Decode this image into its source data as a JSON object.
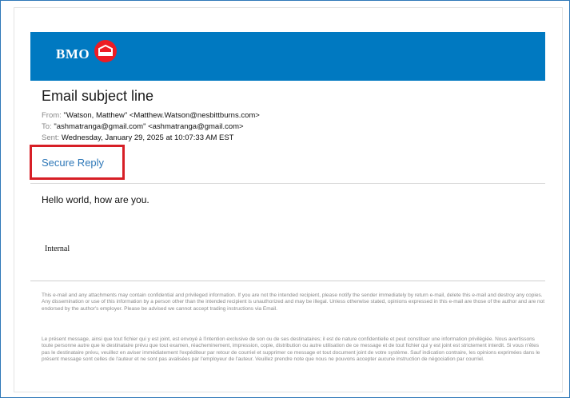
{
  "brand": {
    "name": "BMO",
    "banner_color": "#0079c1",
    "roundel_color": "#ed1c24",
    "roundel_icon": "bmo-roundel-icon"
  },
  "email": {
    "subject": "Email subject line",
    "from_label": "From:",
    "from_value": "\"Watson, Matthew\" <Matthew.Watson@nesbittburns.com>",
    "to_label": "To:",
    "to_value": "\"ashmatranga@gmail.com\" <ashmatranga@gmail.com>",
    "sent_label": "Sent:",
    "sent_value": "Wednesday, January 29, 2025 at 10:07:33 AM EST",
    "secure_reply": "Secure Reply",
    "body": "Hello world, how are you.",
    "classification": "Internal"
  },
  "disclaimer": {
    "english": "This e-mail and any attachments may contain confidential and privileged information. If you are not the intended recipient, please notify the sender immediately by return e-mail, delete this e-mail and destroy any copies. Any dissemination or use of this information by a person other than the intended recipient is unauthorized and may be illegal. Unless otherwise stated, opinions expressed in this e-mail are those of the author and are not endorsed by the author's employer. Please be advised we cannot accept trading instructions via Email.",
    "french": "Le présent message, ainsi que tout fichier qui y est joint, est envoyé à l'intention exclusive de son ou de ses destinataires; il est de nature confidentielle et peut constituer une information privilégiée. Nous avertissons toute personne autre que le destinataire prévu que tout examen, réacheminement, impression, copie, distribution ou autre utilisation de ce message et de tout fichier qui y est joint est strictement interdit. Si vous n'êtes pas le destinataire prévu, veuillez en aviser immédiatement l'expéditeur par retour de courriel et supprimer ce message et tout document joint de votre système. Sauf indication contraire, les opinions exprimées dans le présent message sont celles de l'auteur et ne sont pas avalisées par l'employeur de l'auteur. Veuillez prendre note que nous ne pouvons accepter aucune instruction de négociation par courriel."
  },
  "highlight": {
    "color": "#d71f26"
  }
}
